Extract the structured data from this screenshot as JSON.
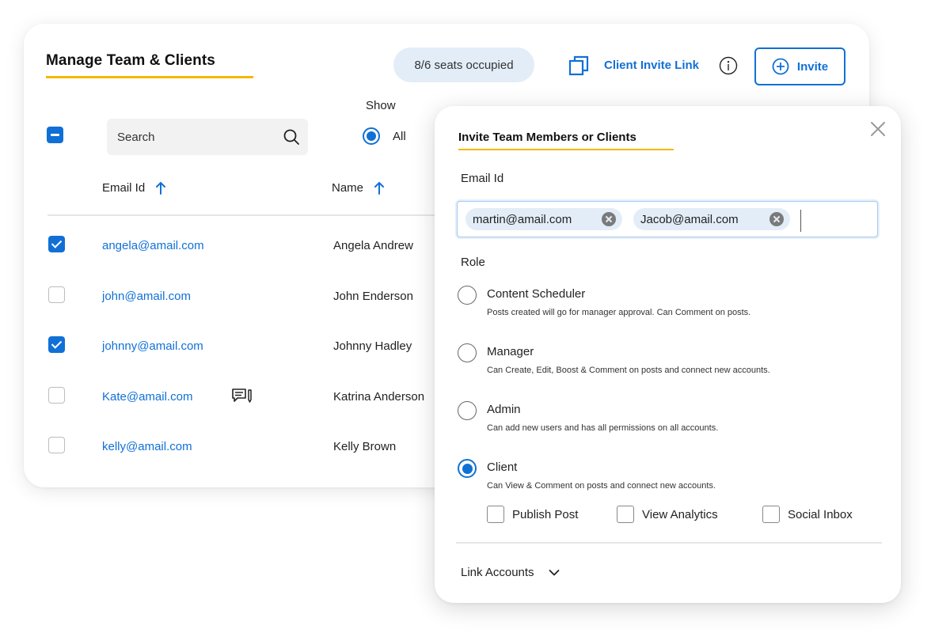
{
  "header": {
    "title": "Manage Team & Clients",
    "seats": "8/6 seats occupied",
    "invite_link_label": "Client Invite Link",
    "invite_button_label": "Invite"
  },
  "filters": {
    "search_placeholder": "Search",
    "show_label": "Show",
    "show_option_selected": "All"
  },
  "table": {
    "columns": [
      "Email Id",
      "Name"
    ],
    "rows": [
      {
        "email": "angela@amail.com",
        "name": "Angela Andrew",
        "checked": true,
        "note": false
      },
      {
        "email": "john@amail.com",
        "name": "John Enderson",
        "checked": false,
        "note": false
      },
      {
        "email": "johnny@amail.com",
        "name": "Johnny Hadley",
        "checked": true,
        "note": false
      },
      {
        "email": "Kate@amail.com",
        "name": "Katrina Anderson",
        "checked": false,
        "note": true
      },
      {
        "email": "kelly@amail.com",
        "name": "Kelly Brown",
        "checked": false,
        "note": false
      }
    ]
  },
  "modal": {
    "title": "Invite Team Members or Clients",
    "email_label": "Email Id",
    "chips": [
      "martin@amail.com",
      "Jacob@amail.com"
    ],
    "role_label": "Role",
    "roles": [
      {
        "name": "Content Scheduler",
        "desc": "Posts created will go for manager approval. Can Comment on posts.",
        "selected": false
      },
      {
        "name": "Manager",
        "desc": "Can Create, Edit, Boost & Comment on posts and connect new accounts.",
        "selected": false
      },
      {
        "name": "Admin",
        "desc": "Can add new users and has all permissions on all accounts.",
        "selected": false
      },
      {
        "name": "Client",
        "desc": "Can View & Comment on posts and connect new accounts.",
        "selected": true
      }
    ],
    "permissions": [
      "Publish Post",
      "View Analytics",
      "Social Inbox"
    ],
    "link_accounts_label": "Link Accounts"
  },
  "colors": {
    "accent": "#1170d6",
    "underline": "#f5b800",
    "badge_bg": "#e3edf8"
  },
  "icons": [
    "copy-icon",
    "info-icon",
    "plus-circle-icon",
    "search-icon",
    "arrow-up-icon",
    "comment-note-icon",
    "close-icon",
    "chip-remove-icon",
    "chevron-down-icon"
  ]
}
